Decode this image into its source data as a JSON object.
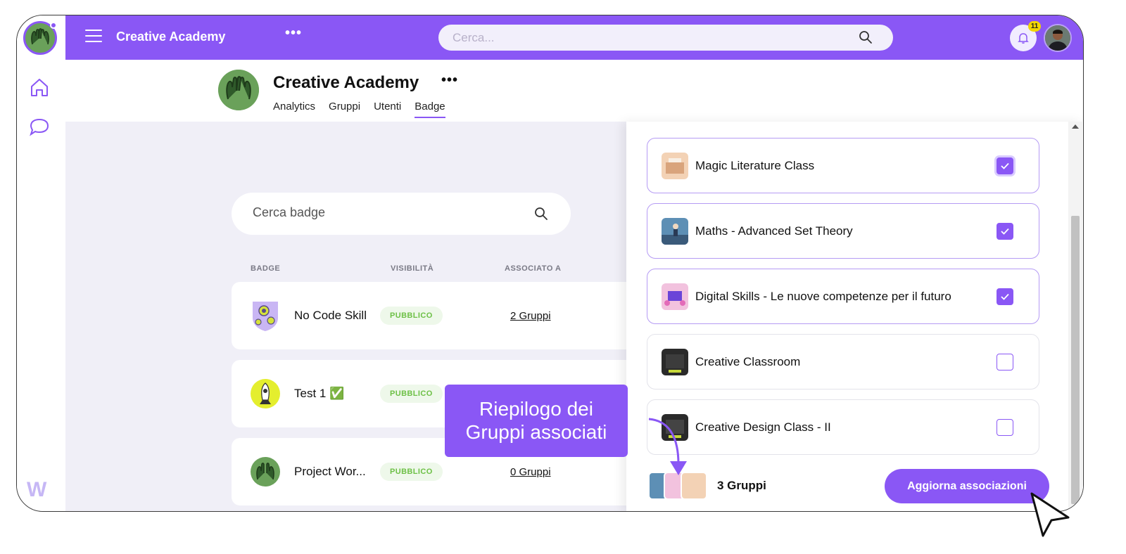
{
  "topbar": {
    "app_title": "Creative Academy",
    "more": "•••",
    "search_placeholder": "Cerca...",
    "notifications_count": "11"
  },
  "org": {
    "title": "Creative Academy",
    "more": "•••",
    "tabs": [
      {
        "label": "Analytics"
      },
      {
        "label": "Gruppi"
      },
      {
        "label": "Utenti"
      },
      {
        "label": "Badge",
        "active": true
      }
    ]
  },
  "badges": {
    "search_placeholder": "Cerca badge",
    "columns": [
      "BADGE",
      "VISIBILITÀ",
      "ASSOCIATO A"
    ],
    "rows": [
      {
        "name": "No Code Skill",
        "visibility": "PUBBLICO",
        "groups": "2 Gruppi"
      },
      {
        "name": "Test 1",
        "emoji": "✅",
        "visibility": "PUBBLICO",
        "groups": ""
      },
      {
        "name": "Project Wor...",
        "visibility": "PUBBLICO",
        "groups": "0 Gruppi"
      }
    ]
  },
  "panel": {
    "groups": [
      {
        "name": "Magic Literature Class",
        "checked": true
      },
      {
        "name": "Maths - Advanced Set Theory",
        "checked": true
      },
      {
        "name": "Digital Skills - Le nuove competenze per il futuro",
        "checked": true
      },
      {
        "name": "Creative Classroom",
        "checked": false
      },
      {
        "name": "Creative Design Class - II",
        "checked": false
      }
    ],
    "footer_count": "3 Gruppi",
    "update_button": "Aggiorna associazioni"
  },
  "tooltip": {
    "line1": "Riepilogo dei",
    "line2": "Gruppi associati"
  },
  "colors": {
    "accent": "#8a57f5",
    "badge_bg": "#eef8ea",
    "badge_text": "#6dc046",
    "content_bg": "#f0eff7"
  }
}
